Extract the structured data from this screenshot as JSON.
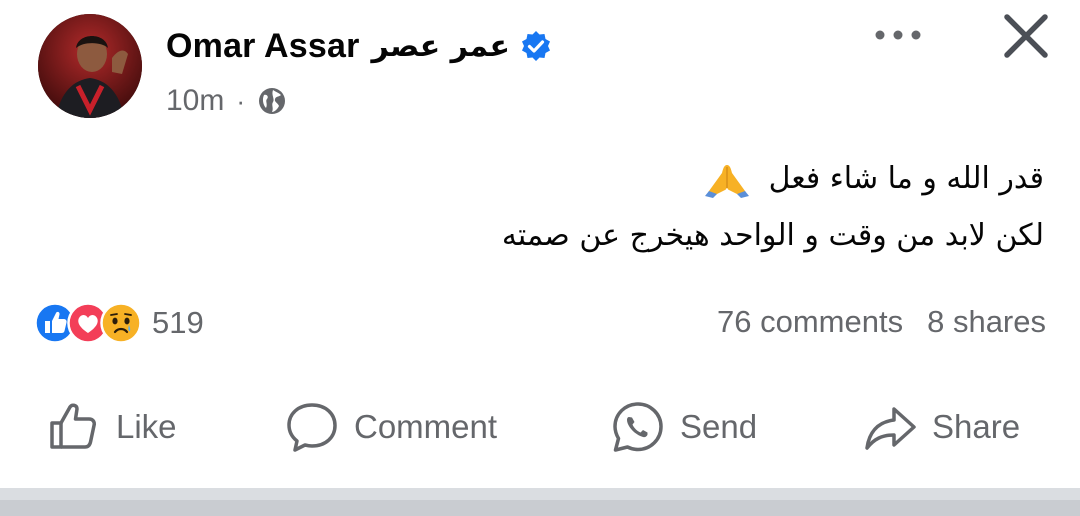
{
  "post": {
    "author_latin": "Omar Assar",
    "author_arabic": "عمر عصر",
    "time": "10m",
    "meta_separator": "·",
    "visibility_icon": "globe-icon",
    "lines": [
      "قدر الله و ما شاء فعل",
      "لكن لابد من وقت و الواحد هيخرج عن صمته"
    ],
    "emoji": "folded-hands"
  },
  "reactions": {
    "types": [
      "like",
      "love",
      "sad"
    ],
    "count": "519"
  },
  "stats": {
    "comments": "76 comments",
    "shares": "8 shares"
  },
  "actions": {
    "like": "Like",
    "comment": "Comment",
    "send": "Send",
    "share": "Share"
  },
  "colors": {
    "accent": "#1877f2",
    "secondary_text": "#65676b",
    "love": "#f33e58",
    "sad": "#f7b125"
  }
}
